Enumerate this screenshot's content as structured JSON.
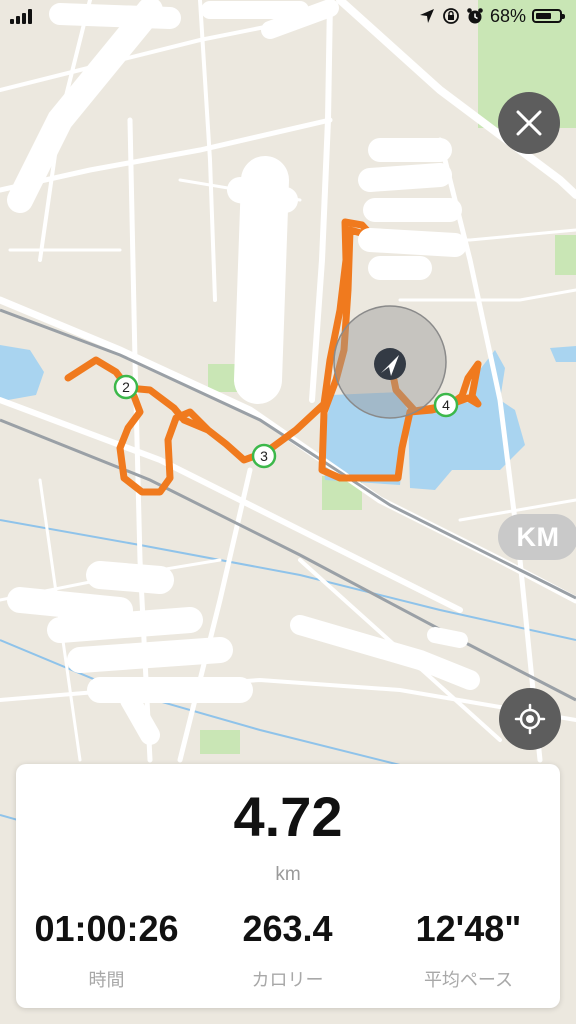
{
  "status_bar": {
    "battery_percent": "68%",
    "battery_level": 0.68,
    "icons": [
      "signal-bars-icon",
      "location-arrow-icon",
      "screen-lock-icon",
      "alarm-clock-icon",
      "battery-icon"
    ]
  },
  "map": {
    "colors": {
      "route": "#f07a1e",
      "water": "#a9d4f0",
      "park": "#c9e6b5",
      "road": "#ffffff",
      "land": "#ece8df"
    },
    "markers": [
      {
        "label": "2"
      },
      {
        "label": "3"
      },
      {
        "label": "4"
      }
    ]
  },
  "controls": {
    "close_icon": "close-icon",
    "unit_toggle": "KM",
    "locate_icon": "crosshair-icon"
  },
  "stats": {
    "distance_value": "4.72",
    "distance_unit": "km",
    "items": [
      {
        "value": "01:00:26",
        "label": "時間"
      },
      {
        "value": "263.4",
        "label": "カロリー"
      },
      {
        "value": "12'48\"",
        "label": "平均ペース"
      }
    ]
  }
}
